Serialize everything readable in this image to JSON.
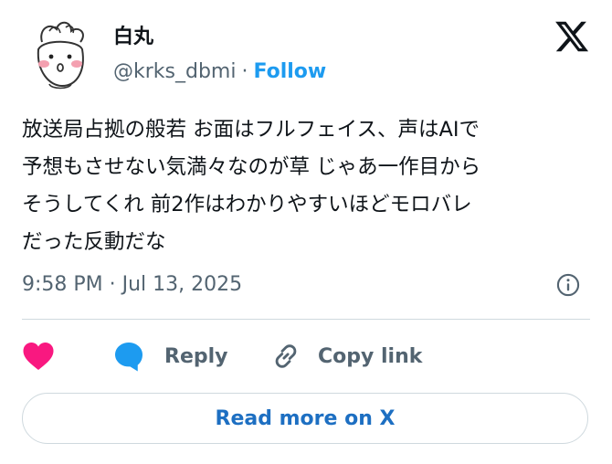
{
  "author": {
    "name": "白丸",
    "handle": "@krks_dbmi",
    "separator": "·",
    "follow_label": "Follow"
  },
  "brand": {
    "logo_icon": "x-logo-icon"
  },
  "tweet": {
    "lines": [
      "放送局占拠の般若 お面はフルフェイス、声はAIで",
      "予想もさせない気満々なのが草 じゃあ一作目から",
      "そうしてくれ 前2作はわかりやすいほどモロバレ",
      "だった反動だな"
    ],
    "timestamp": "9:58 PM · Jul 13, 2025"
  },
  "actions": {
    "like_icon": "heart-icon",
    "reply_label": "Reply",
    "copy_label": "Copy link"
  },
  "read_more_label": "Read more on X",
  "colors": {
    "accent": "#1d9bf0",
    "heart": "#f91880",
    "text": "#0f1419",
    "muted": "#536471",
    "border": "#cfd9de"
  }
}
